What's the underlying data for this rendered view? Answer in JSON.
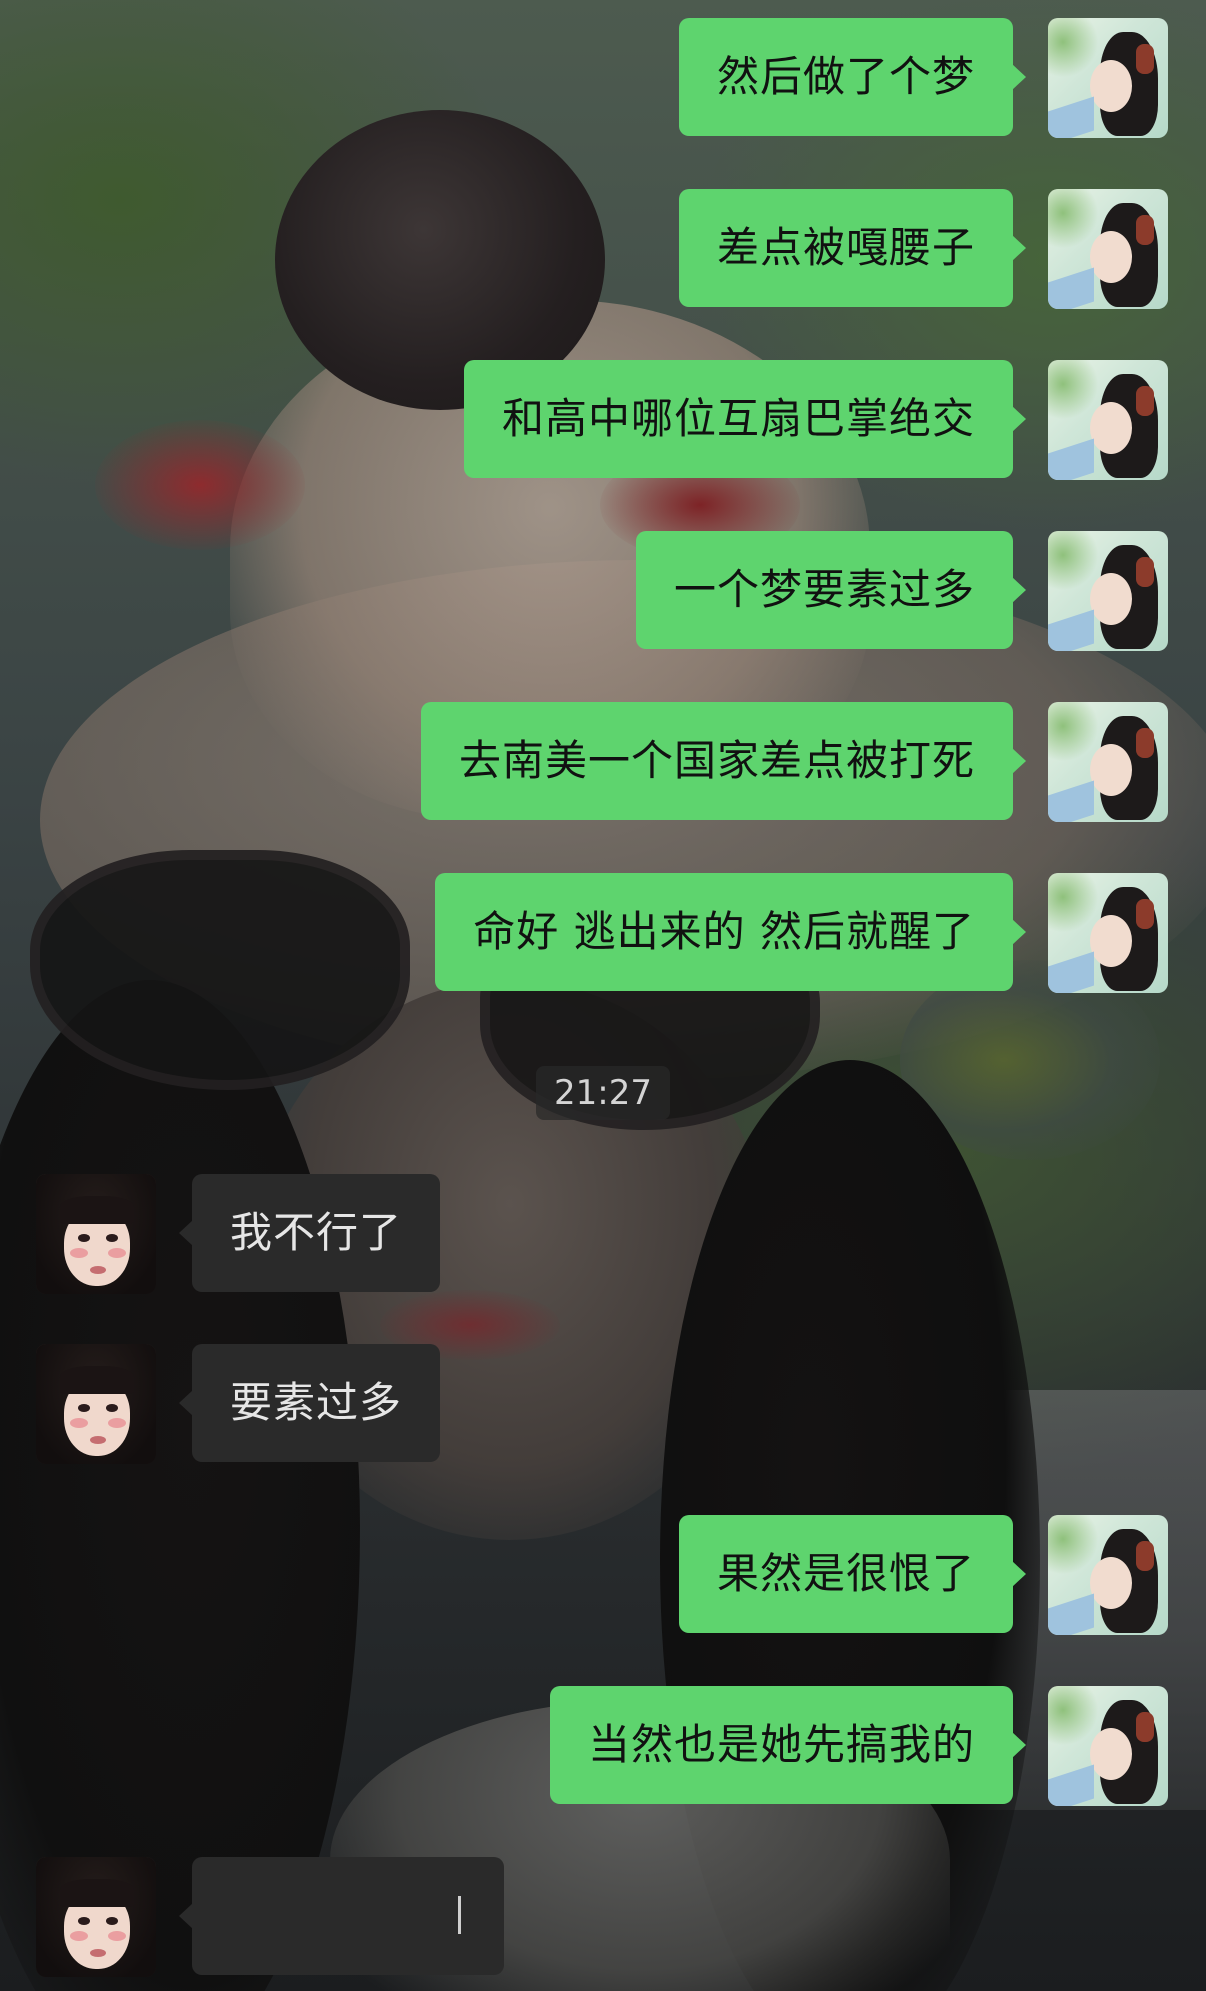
{
  "chat": {
    "messages_before_time": [
      {
        "sender": "self",
        "text": "然后做了个梦"
      },
      {
        "sender": "self",
        "text": "差点被嘎腰子"
      },
      {
        "sender": "self",
        "text": "和高中哪位互扇巴掌绝交"
      },
      {
        "sender": "self",
        "text": "一个梦要素过多"
      },
      {
        "sender": "self",
        "text": "去南美一个国家差点被打死"
      },
      {
        "sender": "self",
        "text": "命好 逃出来的 然后就醒了"
      }
    ],
    "timestamp": "21:27",
    "messages_after_time": [
      {
        "sender": "other",
        "text": "我不行了"
      },
      {
        "sender": "other",
        "text": "要素过多"
      },
      {
        "sender": "self",
        "text": "果然是很恨了"
      },
      {
        "sender": "self",
        "text": "当然也是她先搞我的"
      }
    ],
    "draft": {
      "sender": "other",
      "text": ""
    }
  },
  "colors": {
    "self_bubble": "#5ed46e",
    "other_bubble": "#2a2a2a",
    "self_text": "#111111",
    "other_text": "#e6e6e6"
  }
}
